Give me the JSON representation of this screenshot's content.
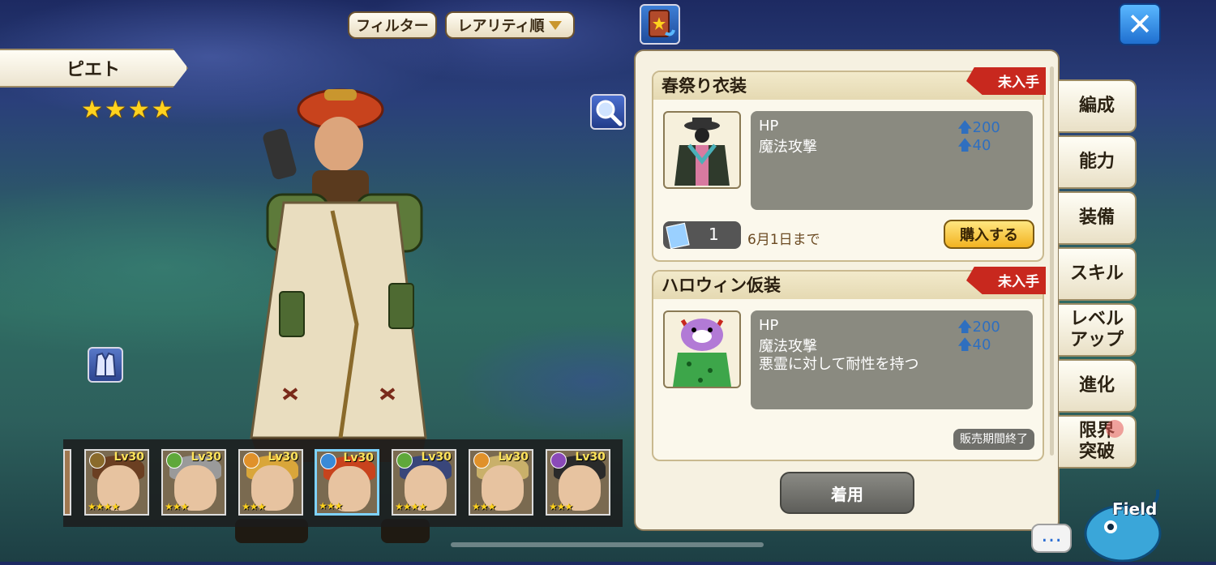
{
  "top": {
    "filter_label": "フィルター",
    "sort_label": "レアリティ順"
  },
  "character": {
    "name": "ピエト",
    "stars": "★★★★"
  },
  "roster": [
    {
      "level": "Lv30",
      "stars": "★★★★"
    },
    {
      "level": "Lv30",
      "stars": "★★★"
    },
    {
      "level": "Lv30",
      "stars": "★★★"
    },
    {
      "level": "Lv30",
      "stars": "★★★"
    },
    {
      "level": "Lv30",
      "stars": "★★★★"
    },
    {
      "level": "Lv30",
      "stars": "★★★"
    },
    {
      "level": "Lv30",
      "stars": "★★★"
    }
  ],
  "panel": {
    "cards": [
      {
        "title": "春祭り衣装",
        "badge": "未入手",
        "stats": [
          {
            "name": "HP",
            "value": "200"
          },
          {
            "name": "魔法攻撃",
            "value": "40"
          }
        ],
        "ticket_count": "1",
        "deadline": "6月1日まで",
        "buy_label": "購入する"
      },
      {
        "title": "ハロウィン仮装",
        "badge": "未入手",
        "stats": [
          {
            "name": "HP",
            "value": "200"
          },
          {
            "name": "魔法攻撃",
            "value": "40"
          }
        ],
        "description": "悪霊に対して耐性を持つ",
        "status": "販売期間終了"
      }
    ],
    "equip_label": "着用"
  },
  "tabs": [
    "編成",
    "能力",
    "装備",
    "スキル",
    "レベル アップ",
    "進化",
    "限界 突破"
  ],
  "field_label": "Field",
  "chat_glyph": "…",
  "close_glyph": "✕",
  "colors": {
    "accent": "#2f6fbf",
    "ribbon": "#c8281e",
    "buy": "#f2b321"
  }
}
